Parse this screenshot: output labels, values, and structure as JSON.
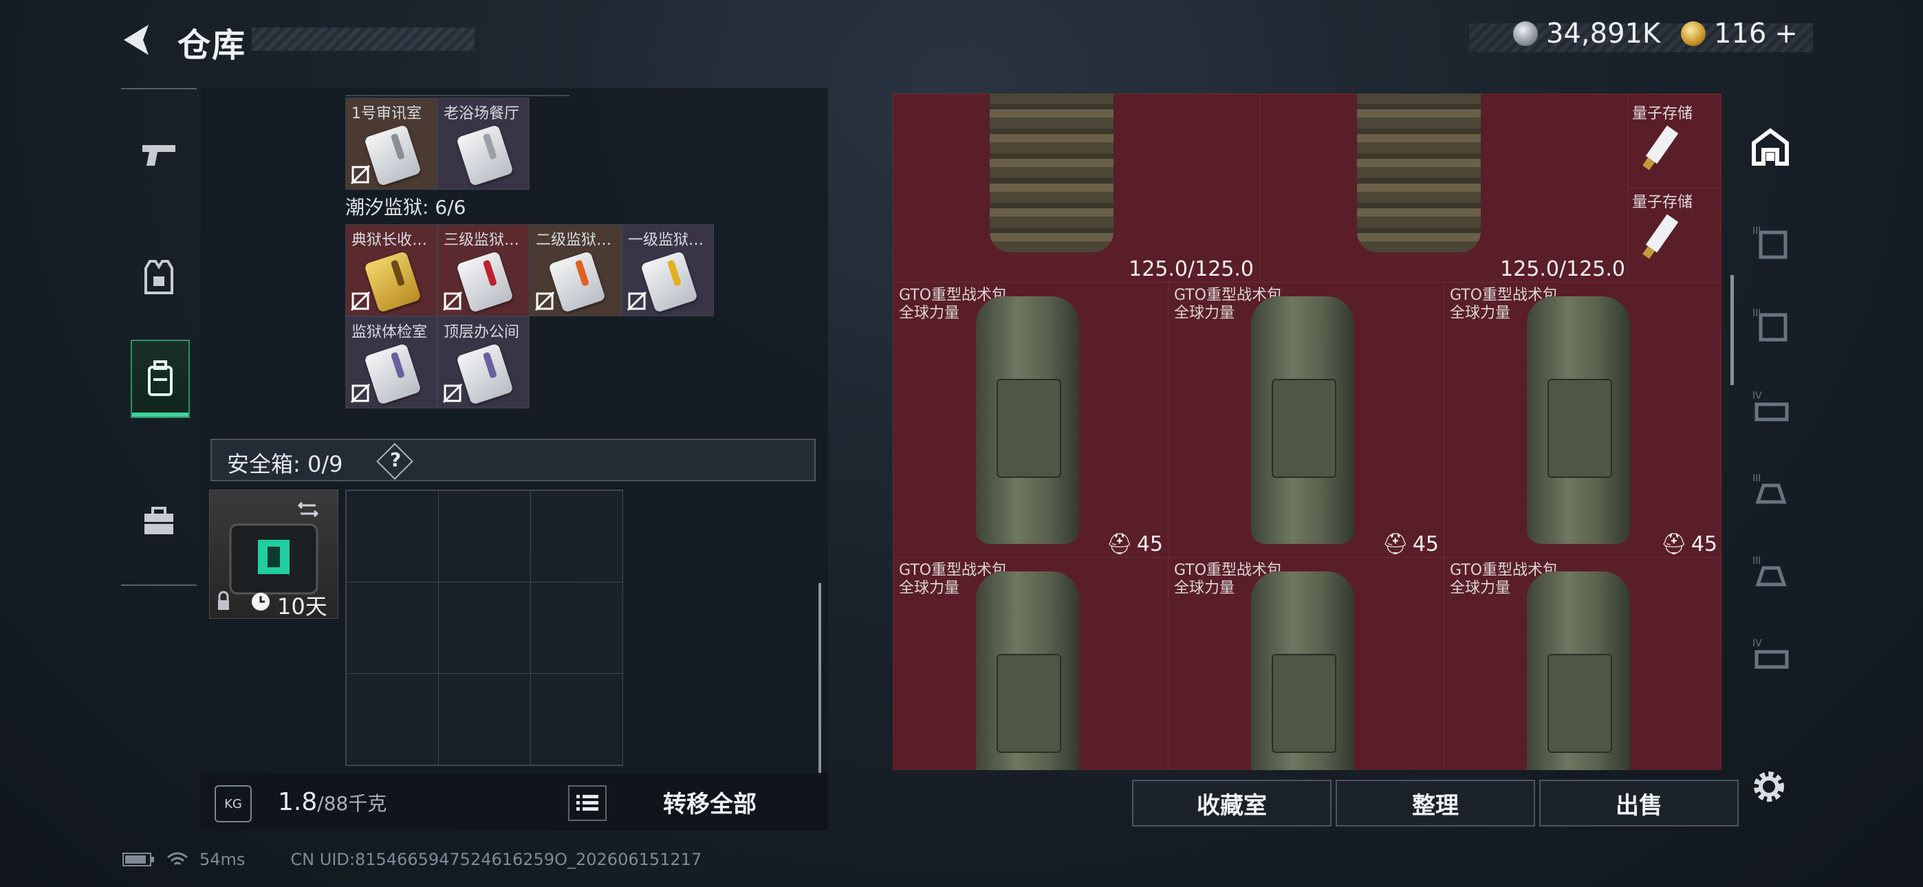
{
  "header": {
    "title": "仓库",
    "currency": {
      "silver": "34,891K",
      "gold": "116",
      "gold_plus": "+"
    }
  },
  "left": {
    "top_cards": [
      {
        "label": "1号审讯室"
      },
      {
        "label": "老浴场餐厅"
      }
    ],
    "prison_label": "潮汐监狱: 6/6",
    "prison_cards": [
      {
        "label": "典狱长收…",
        "stripe": "#e0a020"
      },
      {
        "label": "三级监狱…",
        "stripe": "#c02030"
      },
      {
        "label": "二级监狱…",
        "stripe": "#e06020"
      },
      {
        "label": "一级监狱…",
        "stripe": "#e0b020"
      },
      {
        "label": "监狱体检室",
        "stripe": "#6a60a0"
      },
      {
        "label": "顶层办公间",
        "stripe": "#6a60a0"
      }
    ],
    "safebox_label": "安全箱: 0/9",
    "safebox_help": "?",
    "case_days": "10天",
    "weight_current": "1.8",
    "weight_max": "/88千克",
    "kg_icon_text": "KG",
    "transfer_label": "转移全部"
  },
  "right": {
    "armor_durability": [
      "125.0/125.0",
      "125.0/125.0"
    ],
    "quantum_labels": [
      "量子存储",
      "量子存储"
    ],
    "backpack_name": "GTO重型战术包",
    "backpack_sub": "全球力量",
    "backpack_count": "45",
    "buttons": {
      "collection": "收藏室",
      "organize": "整理",
      "sell": "出售"
    }
  },
  "status": {
    "ping": "54ms",
    "uid": "CN UID:8154665947524616259O_202606151217"
  },
  "colors": {
    "accent_green": "#3fd29a",
    "panel_red": "#5a1e28"
  }
}
